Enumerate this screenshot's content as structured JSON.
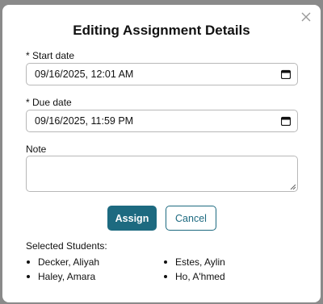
{
  "modal": {
    "title": "Editing Assignment Details",
    "close_icon": "close-icon"
  },
  "form": {
    "start_date": {
      "label": "* Start date",
      "value": "09/16/2025, 12:01 AM",
      "icon": "calendar-icon"
    },
    "due_date": {
      "label": "* Due date",
      "value": "09/16/2025, 11:59 PM",
      "icon": "calendar-icon"
    },
    "note": {
      "label": "Note",
      "value": ""
    }
  },
  "actions": {
    "assign_label": "Assign",
    "cancel_label": "Cancel",
    "primary_color": "#1d6a80"
  },
  "students": {
    "heading": "Selected Students:",
    "items": [
      "Decker, Aliyah",
      "Estes, Aylin",
      "Haley, Amara",
      "Ho, A'hmed"
    ]
  }
}
